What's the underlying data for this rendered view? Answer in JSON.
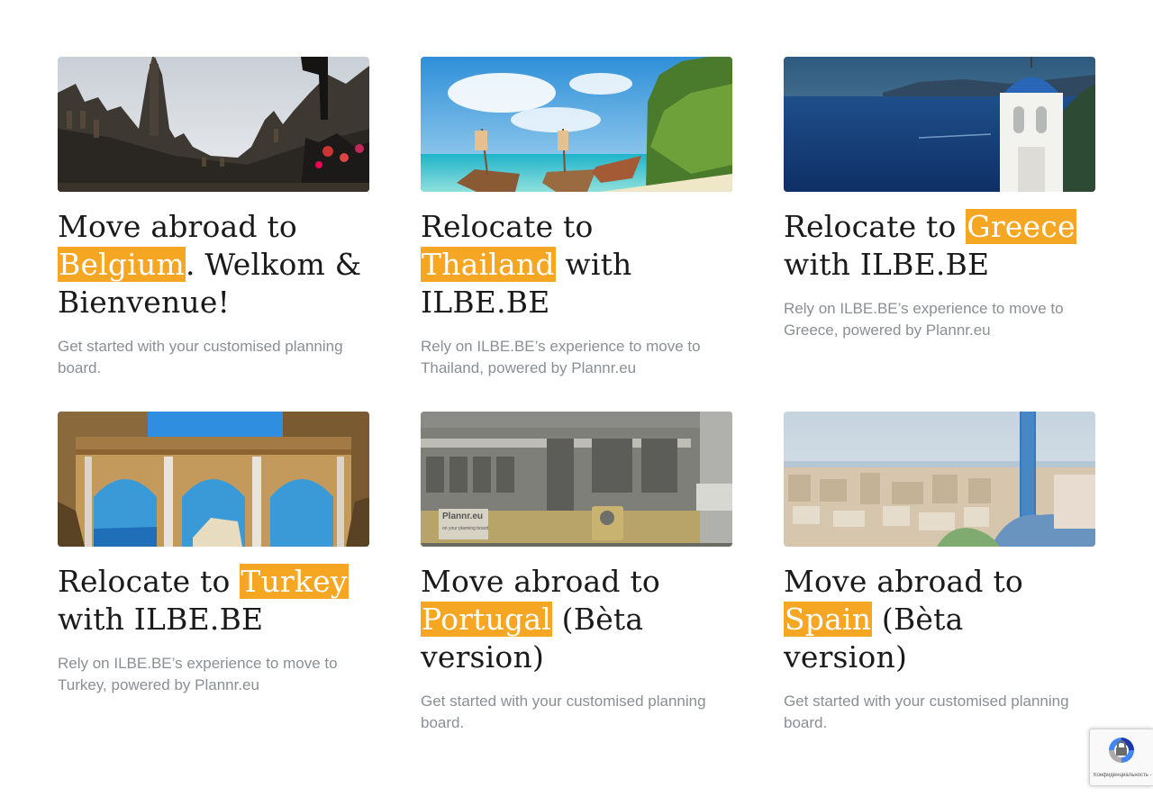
{
  "cards": [
    {
      "title_pre": "Move abroad to ",
      "highlight": "Belgium",
      "title_post": ". Welkom & Bienvenue!",
      "description": "Get started with your customised planning board."
    },
    {
      "title_pre": "Relocate to ",
      "highlight": "Thailand",
      "title_post": " with ILBE.BE",
      "description": "Rely on ILBE.BE’s experience to move to Thailand, powered by Plannr.eu"
    },
    {
      "title_pre": "Relocate to ",
      "highlight": "Greece",
      "title_post": " with ILBE.BE",
      "description": "Rely on ILBE.BE’s experience to move to Greece, powered by Plannr.eu"
    },
    {
      "title_pre": "Relocate to ",
      "highlight": "Turkey",
      "title_post": " with ILBE.BE",
      "description": "Rely on ILBE.BE’s experience to move to Turkey, powered by Plannr.eu"
    },
    {
      "title_pre": "Move abroad to ",
      "highlight": "Portugal",
      "title_post": " (Bèta version)",
      "description": "Get started with your customised planning board.",
      "image_text": [
        "Plannr.eu",
        "on your planning board"
      ]
    },
    {
      "title_pre": "Move abroad to ",
      "highlight": "Spain",
      "title_post": " (Bèta version)",
      "description": "Get started with your customised planning board."
    }
  ],
  "recaptcha": {
    "text": "Конфиденциальность - Условия использования"
  },
  "colors": {
    "highlight": "#f5a623",
    "title": "#1a1a1a",
    "description": "#8a8f94"
  },
  "icons": {
    "recaptcha": "recaptcha-icon"
  }
}
